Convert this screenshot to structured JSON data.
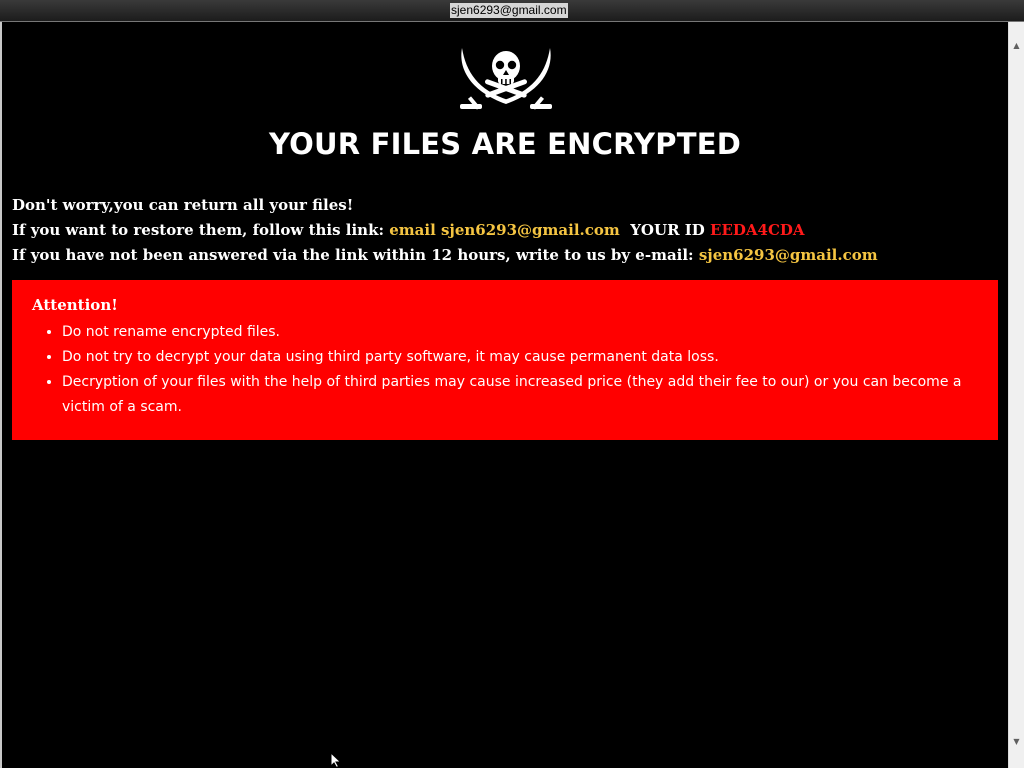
{
  "window": {
    "title": "sjen6293@gmail.com"
  },
  "logo": {
    "icon": "jolly-roger-skull-crossed-swords-icon"
  },
  "headline": "YOUR FILES ARE ENCRYPTED",
  "intro": {
    "line1": "Don't worry,you can return all your files!",
    "line2_prefix": "If you want to restore them, follow this link: ",
    "line2_email": "email sjen6293@gmail.com",
    "line2_id_label": "YOUR ID ",
    "line2_id_value": "EEDA4CDA",
    "line3_prefix": "If you have not been answered via the link within 12 hours, write to us by e-mail: ",
    "line3_email": "sjen6293@gmail.com"
  },
  "attention": {
    "title": "Attention!",
    "items": [
      "Do not rename encrypted files.",
      "Do not try to decrypt your data using third party software, it may cause permanent data loss.",
      "Decryption of your files with the help of third parties may cause increased price (they add their fee to our) or you can become a victim of a scam."
    ]
  },
  "colors": {
    "background": "#000000",
    "text": "#ffffff",
    "email_highlight": "#f5c542",
    "id_highlight": "#ff1a1a",
    "attention_box": "#ff0000"
  }
}
